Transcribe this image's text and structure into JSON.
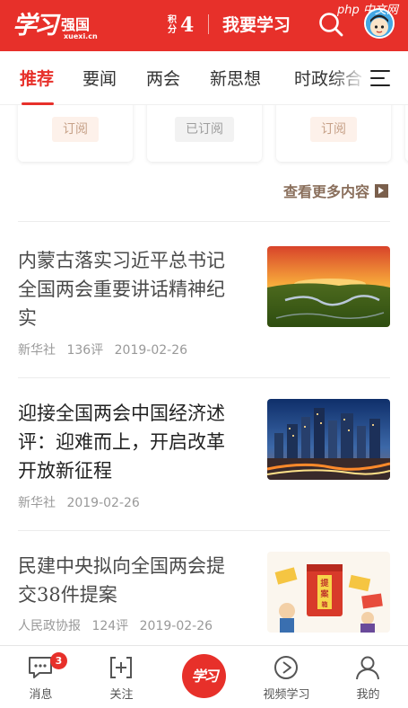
{
  "header": {
    "logo_calligraphy": "学习",
    "logo_name": "强国",
    "logo_domain": "xuexi.cn",
    "score_label": "积分",
    "score_value": "4",
    "learn_button": "我要学习",
    "watermark": "php 中文网"
  },
  "tabs": [
    {
      "label": "推荐",
      "active": true
    },
    {
      "label": "要闻",
      "active": false
    },
    {
      "label": "两会",
      "active": false
    },
    {
      "label": "新思想",
      "active": false
    },
    {
      "label": "时政综合",
      "active": false
    }
  ],
  "subscriptions": [
    {
      "button": "订阅",
      "state": "subscribe"
    },
    {
      "button": "已订阅",
      "state": "subscribed"
    },
    {
      "button": "订阅",
      "state": "subscribe"
    }
  ],
  "more_link": "查看更多内容",
  "news": [
    {
      "title": "内蒙古落实习近平总书记全国两会重要讲话精神纪实",
      "source": "新华社",
      "comments": "136评",
      "date": "2019-02-26",
      "read": true,
      "image": "grassland-sunset"
    },
    {
      "title": "迎接全国两会中国经济述评：迎难而上，开启改革开放新征程",
      "source": "新华社",
      "comments": "",
      "date": "2019-02-26",
      "read": false,
      "image": "city-night-skyline"
    },
    {
      "title": "民建中央拟向全国两会提交38件提案",
      "source": "人民政协报",
      "comments": "124评",
      "date": "2019-02-26",
      "read": true,
      "image": "proposal-box-cartoon"
    }
  ],
  "bottom_nav": {
    "messages": {
      "label": "消息",
      "badge": "3"
    },
    "follow": {
      "label": "关注"
    },
    "center": {
      "label": "学习"
    },
    "video": {
      "label": "视频学习"
    },
    "mine": {
      "label": "我的"
    }
  },
  "colors": {
    "brand_red": "#e7302a",
    "subscribe_text": "#c6a188",
    "subscribe_bg": "#fdf1ea",
    "meta_gray": "#999999"
  },
  "icons": {
    "search": "search-icon",
    "menu": "menu-icon",
    "messages": "chat-bubble-icon",
    "follow": "plus-square-icon",
    "video": "play-circle-icon",
    "mine": "person-icon",
    "more": "arrow-right-box-icon"
  }
}
